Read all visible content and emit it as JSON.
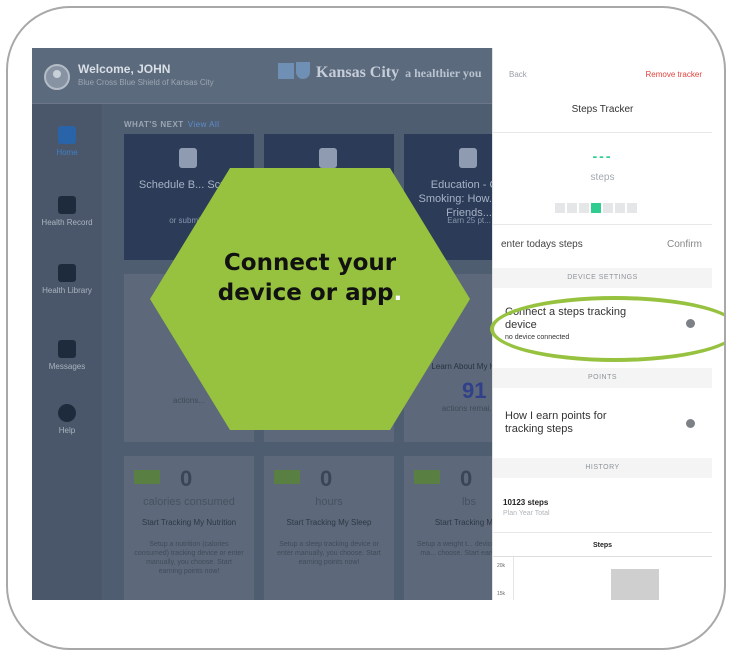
{
  "header": {
    "welcome": "Welcome, JOHN",
    "org": "Blue Cross Blue Shield of Kansas City",
    "brand_city": "Kansas City",
    "brand_tag": "a healthier you"
  },
  "sidebar": {
    "items": [
      {
        "label": "Home",
        "icon": "home-icon",
        "active": true
      },
      {
        "label": "Health Record",
        "icon": "record-icon"
      },
      {
        "label": "Health Library",
        "icon": "book-icon"
      },
      {
        "label": "Messages",
        "icon": "message-icon"
      },
      {
        "label": "Help",
        "icon": "info-icon"
      }
    ]
  },
  "whats_next": {
    "label": "WHAT'S NEXT",
    "link": "View All"
  },
  "dark_cards": [
    {
      "title": "Schedule B... Scre...",
      "sub": "or submit...",
      "icon": "fingerprint-icon"
    },
    {
      "title": "",
      "sub": "",
      "icon": "clipboard-icon"
    },
    {
      "title": "Education - O... Smoking: How... and Friends...",
      "sub": "Earn 25 pt...",
      "icon": "book-icon"
    }
  ],
  "mid_cards": [
    {
      "label": "P...",
      "sub": "actions..."
    },
    {
      "label": "",
      "sub": ""
    },
    {
      "label": "Learn About My He...",
      "num": "91",
      "sub": "actions remai..."
    }
  ],
  "tracker_cards": [
    {
      "num": "0",
      "unit": "calories consumed",
      "title": "Start Tracking My Nutrition",
      "desc": "Setup a nutrition (calories consumed) tracking device or enter manually, you choose. Start earning points now!"
    },
    {
      "num": "0",
      "unit": "hours",
      "title": "Start Tracking My Sleep",
      "desc": "Setup a sleep tracking device or enter manually, you choose. Start earning points now!"
    },
    {
      "num": "0",
      "unit": "lbs",
      "title": "Start Tracking My...",
      "desc": "Setup a weight t... device or enter ma... choose. Start earn... now!"
    }
  ],
  "panel": {
    "back": "Back",
    "remove": "Remove tracker",
    "title": "Steps Tracker",
    "value_placeholder": "---",
    "unit": "steps",
    "entry_placeholder": "enter todays steps",
    "confirm": "Confirm",
    "device_settings": "DEVICE SETTINGS",
    "connect_line1": "Connect a steps tracking",
    "connect_line2": "device",
    "no_device": "no device connected",
    "points": "POINTS",
    "earn_line1": "How I earn points for",
    "earn_line2": "tracking steps",
    "history": "HISTORY",
    "history_total": "10123 steps",
    "history_sub": "Plan Year Total",
    "chart_title": "Steps",
    "axis_20k": "20k",
    "axis_15k": "15k"
  },
  "callout": {
    "line1": "Connect your",
    "line2": "device or app",
    "dot": "."
  },
  "colors": {
    "hexagon": "#96c23f",
    "accent_green": "#2ecc8f",
    "remove_red": "#e0433d"
  }
}
